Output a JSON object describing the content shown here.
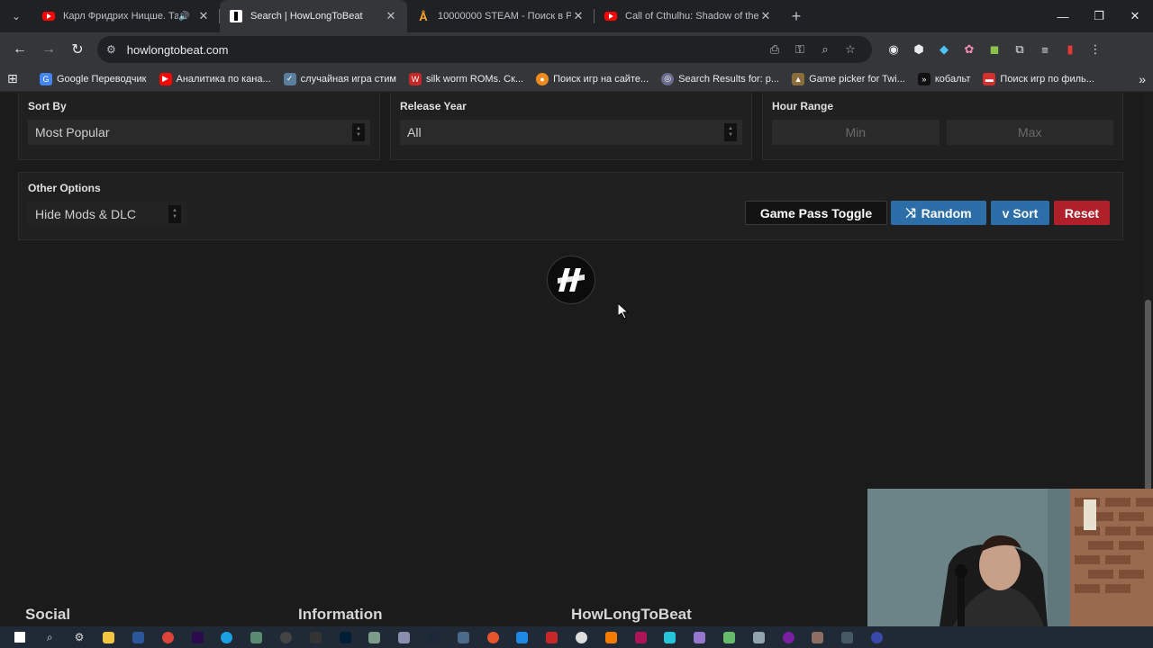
{
  "browser": {
    "tabs": [
      {
        "title": "Карл Фридрих Ницше. Так",
        "icon": "youtube-icon",
        "active": false,
        "audio": true
      },
      {
        "title": "Search | HowLongToBeat",
        "icon": "hltb-icon",
        "active": true
      },
      {
        "title": "10000000 STEAM - Поиск в Pla",
        "icon": "plati-icon",
        "active": false
      },
      {
        "title": "Call of Cthulhu: Shadow of the",
        "icon": "youtube-icon",
        "active": false
      }
    ],
    "url": "howlongtobeat.com",
    "bookmarks": [
      {
        "label": "Google Переводчик",
        "color": "#4285f4"
      },
      {
        "label": "Аналитика по кана...",
        "color": "#ff0000"
      },
      {
        "label": "случайная игра стим",
        "color": "#5c7e9e"
      },
      {
        "label": "silk worm ROMs. Ск...",
        "color": "#c62828"
      },
      {
        "label": "Поиск игр на сайте...",
        "color": "#ef8a1c"
      },
      {
        "label": "Search Results for: p...",
        "color": "#6b6b8e"
      },
      {
        "label": "Game picker for Twi...",
        "color": "#8a6d3b"
      },
      {
        "label": "кобальт",
        "color": "#111111"
      },
      {
        "label": "Поиск игр по филь...",
        "color": "#d32f2f"
      }
    ]
  },
  "filters": {
    "sort_by": {
      "label": "Sort By",
      "value": "Most Popular"
    },
    "release_year": {
      "label": "Release Year",
      "value": "All"
    },
    "hour_range": {
      "label": "Hour Range",
      "min_placeholder": "Min",
      "max_placeholder": "Max"
    },
    "other_options": {
      "label": "Other Options",
      "value": "Hide Mods & DLC"
    }
  },
  "buttons": {
    "game_pass": "Game Pass Toggle",
    "random": "Random",
    "sort": "v Sort",
    "reset": "Reset"
  },
  "footer": {
    "social": "Social",
    "information": "Information",
    "brand": "HowLongToBeat"
  },
  "colors": {
    "accent_blue": "#2b6ea8",
    "reset_red": "#b0202a",
    "page_bg": "#1b1b1b"
  }
}
